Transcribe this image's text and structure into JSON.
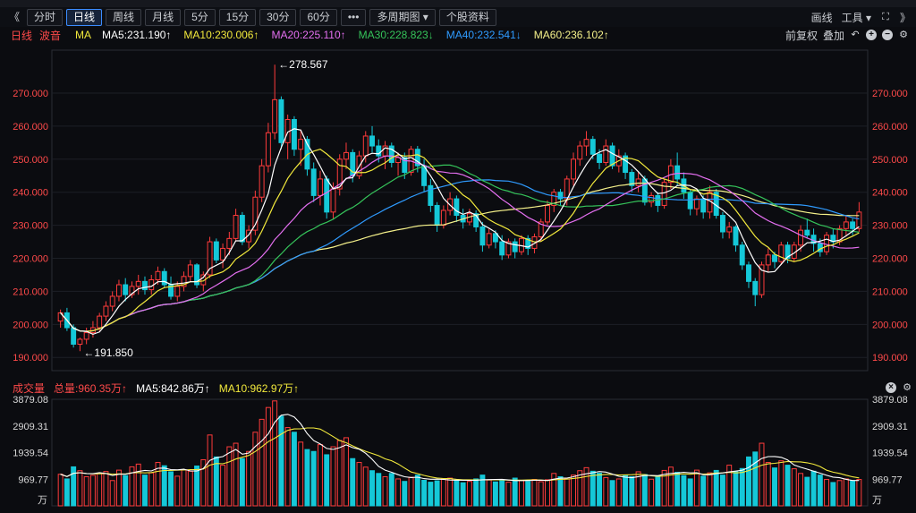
{
  "toolbar": {
    "nav_back": "《",
    "periods": [
      "分时",
      "日线",
      "周线",
      "月线",
      "5分",
      "15分",
      "30分",
      "60分"
    ],
    "active_period": "日线",
    "more": "•••",
    "multi_period": "多周期图 ▾",
    "stock_info": "个股资料",
    "draw": "画线",
    "tools": "工具 ▾",
    "nav_forward": "》"
  },
  "indicator_row": {
    "period": "日线",
    "wave": "波音",
    "ma": "MA",
    "ma5": "MA5:231.190↑",
    "ma10": "MA10:230.006↑",
    "ma20": "MA20:225.110↑",
    "ma30": "MA30:228.823↓",
    "ma40": "MA40:232.541↓",
    "ma60": "MA60:236.102↑",
    "adjust": "前复权",
    "overlay": "叠加"
  },
  "volume_row": {
    "label": "成交量",
    "total": "总量:960.35万↑",
    "ma5": "MA5:842.86万↑",
    "ma10": "MA10:962.97万↑"
  },
  "colors": {
    "up": "#ff3b3b",
    "down": "#15c8d8",
    "ma5": "#ffffff",
    "ma10": "#f2e93c",
    "ma20": "#e46ff0",
    "ma30": "#35c35a",
    "ma40": "#2f9bff",
    "ma60": "#f4f08a",
    "axis_text": "#ff4a4a",
    "vol_axis_text": "#d8d8d8"
  },
  "chart_data": {
    "type": "candlestick",
    "price_ticks": [
      "270.000",
      "260.000",
      "250.000",
      "240.000",
      "230.000",
      "220.000",
      "210.000",
      "200.000",
      "190.000"
    ],
    "price_ylim": [
      186,
      283
    ],
    "annotations": {
      "high": "←278.567",
      "low": "←191.850"
    },
    "volume_ticks": [
      "3879.08",
      "2909.31",
      "1939.54",
      "969.77"
    ],
    "volume_unit": "万",
    "volume_ylim": [
      0,
      3879.08
    ],
    "candles": [
      {
        "o": 201.0,
        "h": 204.5,
        "l": 199.0,
        "c": 203.5
      },
      {
        "o": 203.5,
        "h": 205.0,
        "l": 198.0,
        "c": 199.0
      },
      {
        "o": 199.0,
        "h": 200.0,
        "l": 193.0,
        "c": 194.0
      },
      {
        "o": 194.0,
        "h": 196.0,
        "l": 191.9,
        "c": 195.5
      },
      {
        "o": 195.5,
        "h": 199.0,
        "l": 194.0,
        "c": 197.5
      },
      {
        "o": 197.5,
        "h": 201.0,
        "l": 196.0,
        "c": 199.0
      },
      {
        "o": 199.0,
        "h": 203.5,
        "l": 198.0,
        "c": 202.5
      },
      {
        "o": 202.5,
        "h": 207.0,
        "l": 201.0,
        "c": 205.5
      },
      {
        "o": 205.5,
        "h": 210.0,
        "l": 204.0,
        "c": 208.5
      },
      {
        "o": 208.5,
        "h": 213.5,
        "l": 207.0,
        "c": 212.0
      },
      {
        "o": 212.0,
        "h": 214.0,
        "l": 207.0,
        "c": 209.0
      },
      {
        "o": 209.0,
        "h": 213.0,
        "l": 208.0,
        "c": 211.5
      },
      {
        "o": 211.5,
        "h": 215.0,
        "l": 209.0,
        "c": 213.0
      },
      {
        "o": 213.0,
        "h": 214.5,
        "l": 209.0,
        "c": 210.5
      },
      {
        "o": 210.5,
        "h": 215.0,
        "l": 209.0,
        "c": 213.5
      },
      {
        "o": 213.5,
        "h": 217.5,
        "l": 212.0,
        "c": 216.0
      },
      {
        "o": 216.0,
        "h": 217.0,
        "l": 211.0,
        "c": 212.0
      },
      {
        "o": 212.0,
        "h": 214.5,
        "l": 207.5,
        "c": 208.5
      },
      {
        "o": 208.5,
        "h": 213.0,
        "l": 207.0,
        "c": 211.5
      },
      {
        "o": 211.5,
        "h": 216.0,
        "l": 210.0,
        "c": 214.5
      },
      {
        "o": 214.5,
        "h": 219.5,
        "l": 213.0,
        "c": 218.0
      },
      {
        "o": 218.0,
        "h": 218.5,
        "l": 211.0,
        "c": 212.0
      },
      {
        "o": 212.0,
        "h": 216.0,
        "l": 210.0,
        "c": 215.0
      },
      {
        "o": 215.0,
        "h": 226.5,
        "l": 214.0,
        "c": 225.0
      },
      {
        "o": 225.0,
        "h": 226.0,
        "l": 218.5,
        "c": 219.5
      },
      {
        "o": 219.5,
        "h": 224.5,
        "l": 217.0,
        "c": 223.0
      },
      {
        "o": 223.0,
        "h": 228.0,
        "l": 221.0,
        "c": 226.0
      },
      {
        "o": 226.0,
        "h": 235.0,
        "l": 225.0,
        "c": 233.0
      },
      {
        "o": 233.0,
        "h": 234.0,
        "l": 224.0,
        "c": 225.0
      },
      {
        "o": 225.0,
        "h": 230.0,
        "l": 223.0,
        "c": 228.5
      },
      {
        "o": 228.5,
        "h": 240.5,
        "l": 227.0,
        "c": 238.5
      },
      {
        "o": 238.5,
        "h": 250.0,
        "l": 237.0,
        "c": 248.0
      },
      {
        "o": 248.0,
        "h": 261.0,
        "l": 246.0,
        "c": 258.0
      },
      {
        "o": 258.0,
        "h": 278.6,
        "l": 256.0,
        "c": 268.0
      },
      {
        "o": 268.0,
        "h": 269.0,
        "l": 253.0,
        "c": 255.0
      },
      {
        "o": 255.0,
        "h": 263.5,
        "l": 250.0,
        "c": 262.0
      },
      {
        "o": 262.0,
        "h": 263.0,
        "l": 251.0,
        "c": 253.0
      },
      {
        "o": 253.0,
        "h": 259.0,
        "l": 248.0,
        "c": 256.0
      },
      {
        "o": 256.0,
        "h": 257.0,
        "l": 245.0,
        "c": 247.0
      },
      {
        "o": 247.0,
        "h": 249.0,
        "l": 237.0,
        "c": 239.0
      },
      {
        "o": 239.0,
        "h": 246.5,
        "l": 236.0,
        "c": 244.0
      },
      {
        "o": 244.0,
        "h": 245.0,
        "l": 232.0,
        "c": 234.0
      },
      {
        "o": 234.0,
        "h": 243.0,
        "l": 232.0,
        "c": 241.0
      },
      {
        "o": 241.0,
        "h": 251.5,
        "l": 239.0,
        "c": 250.0
      },
      {
        "o": 250.0,
        "h": 255.0,
        "l": 247.0,
        "c": 252.0
      },
      {
        "o": 252.0,
        "h": 253.0,
        "l": 243.0,
        "c": 245.0
      },
      {
        "o": 245.0,
        "h": 252.5,
        "l": 244.0,
        "c": 251.0
      },
      {
        "o": 251.0,
        "h": 258.5,
        "l": 249.0,
        "c": 257.0
      },
      {
        "o": 257.0,
        "h": 260.0,
        "l": 252.0,
        "c": 254.0
      },
      {
        "o": 254.0,
        "h": 256.0,
        "l": 249.0,
        "c": 251.0
      },
      {
        "o": 251.0,
        "h": 255.5,
        "l": 247.0,
        "c": 254.0
      },
      {
        "o": 254.0,
        "h": 255.0,
        "l": 247.5,
        "c": 249.0
      },
      {
        "o": 249.0,
        "h": 252.0,
        "l": 245.0,
        "c": 250.5
      },
      {
        "o": 250.5,
        "h": 252.0,
        "l": 244.0,
        "c": 246.0
      },
      {
        "o": 246.0,
        "h": 254.0,
        "l": 245.0,
        "c": 253.0
      },
      {
        "o": 253.0,
        "h": 254.0,
        "l": 246.0,
        "c": 248.0
      },
      {
        "o": 248.0,
        "h": 250.0,
        "l": 240.0,
        "c": 242.0
      },
      {
        "o": 242.0,
        "h": 244.0,
        "l": 234.0,
        "c": 236.0
      },
      {
        "o": 236.0,
        "h": 237.0,
        "l": 228.0,
        "c": 230.0
      },
      {
        "o": 230.0,
        "h": 236.0,
        "l": 229.0,
        "c": 234.5
      },
      {
        "o": 234.5,
        "h": 240.0,
        "l": 233.0,
        "c": 238.0
      },
      {
        "o": 238.0,
        "h": 239.0,
        "l": 231.0,
        "c": 233.0
      },
      {
        "o": 233.0,
        "h": 235.0,
        "l": 229.0,
        "c": 231.0
      },
      {
        "o": 231.0,
        "h": 235.0,
        "l": 230.0,
        "c": 233.5
      },
      {
        "o": 233.5,
        "h": 234.5,
        "l": 228.0,
        "c": 229.5
      },
      {
        "o": 229.5,
        "h": 231.0,
        "l": 222.0,
        "c": 224.0
      },
      {
        "o": 224.0,
        "h": 229.0,
        "l": 223.0,
        "c": 227.5
      },
      {
        "o": 227.5,
        "h": 228.5,
        "l": 223.0,
        "c": 225.0
      },
      {
        "o": 225.0,
        "h": 227.0,
        "l": 219.5,
        "c": 221.0
      },
      {
        "o": 221.0,
        "h": 226.0,
        "l": 220.0,
        "c": 225.0
      },
      {
        "o": 225.0,
        "h": 226.0,
        "l": 220.0,
        "c": 222.0
      },
      {
        "o": 222.0,
        "h": 227.0,
        "l": 221.0,
        "c": 226.0
      },
      {
        "o": 226.0,
        "h": 227.0,
        "l": 221.0,
        "c": 223.0
      },
      {
        "o": 223.0,
        "h": 227.5,
        "l": 221.5,
        "c": 226.5
      },
      {
        "o": 226.5,
        "h": 232.0,
        "l": 225.0,
        "c": 231.0
      },
      {
        "o": 231.0,
        "h": 237.5,
        "l": 230.0,
        "c": 236.0
      },
      {
        "o": 236.0,
        "h": 241.0,
        "l": 234.0,
        "c": 240.0
      },
      {
        "o": 240.0,
        "h": 241.0,
        "l": 236.0,
        "c": 238.0
      },
      {
        "o": 238.0,
        "h": 245.0,
        "l": 236.0,
        "c": 244.0
      },
      {
        "o": 244.0,
        "h": 252.0,
        "l": 242.0,
        "c": 250.0
      },
      {
        "o": 250.0,
        "h": 255.5,
        "l": 248.0,
        "c": 254.0
      },
      {
        "o": 254.0,
        "h": 258.5,
        "l": 251.0,
        "c": 256.0
      },
      {
        "o": 256.0,
        "h": 257.0,
        "l": 250.0,
        "c": 251.5
      },
      {
        "o": 251.5,
        "h": 253.0,
        "l": 247.0,
        "c": 249.0
      },
      {
        "o": 249.0,
        "h": 256.0,
        "l": 248.0,
        "c": 254.0
      },
      {
        "o": 254.0,
        "h": 255.0,
        "l": 247.0,
        "c": 248.0
      },
      {
        "o": 248.0,
        "h": 253.0,
        "l": 246.0,
        "c": 251.0
      },
      {
        "o": 251.0,
        "h": 252.0,
        "l": 244.0,
        "c": 246.0
      },
      {
        "o": 246.0,
        "h": 247.0,
        "l": 240.0,
        "c": 242.0
      },
      {
        "o": 242.0,
        "h": 246.0,
        "l": 240.0,
        "c": 244.0
      },
      {
        "o": 244.0,
        "h": 245.0,
        "l": 236.0,
        "c": 237.0
      },
      {
        "o": 237.0,
        "h": 240.0,
        "l": 235.5,
        "c": 239.0
      },
      {
        "o": 239.0,
        "h": 240.0,
        "l": 234.0,
        "c": 236.0
      },
      {
        "o": 236.0,
        "h": 244.0,
        "l": 235.0,
        "c": 243.0
      },
      {
        "o": 243.0,
        "h": 250.0,
        "l": 241.0,
        "c": 248.0
      },
      {
        "o": 248.0,
        "h": 252.0,
        "l": 242.0,
        "c": 244.0
      },
      {
        "o": 244.0,
        "h": 246.0,
        "l": 238.0,
        "c": 240.0
      },
      {
        "o": 240.0,
        "h": 241.0,
        "l": 233.0,
        "c": 235.0
      },
      {
        "o": 235.0,
        "h": 239.0,
        "l": 233.0,
        "c": 238.0
      },
      {
        "o": 238.0,
        "h": 239.0,
        "l": 232.0,
        "c": 234.0
      },
      {
        "o": 234.0,
        "h": 242.0,
        "l": 232.0,
        "c": 240.0
      },
      {
        "o": 240.0,
        "h": 241.0,
        "l": 232.0,
        "c": 233.0
      },
      {
        "o": 233.0,
        "h": 234.0,
        "l": 226.0,
        "c": 228.0
      },
      {
        "o": 228.0,
        "h": 231.0,
        "l": 226.0,
        "c": 229.5
      },
      {
        "o": 229.5,
        "h": 230.0,
        "l": 222.0,
        "c": 224.0
      },
      {
        "o": 224.0,
        "h": 225.0,
        "l": 216.5,
        "c": 218.0
      },
      {
        "o": 218.0,
        "h": 219.0,
        "l": 211.0,
        "c": 213.0
      },
      {
        "o": 213.0,
        "h": 214.0,
        "l": 205.5,
        "c": 209.0
      },
      {
        "o": 209.0,
        "h": 219.0,
        "l": 208.0,
        "c": 218.0
      },
      {
        "o": 218.0,
        "h": 223.0,
        "l": 216.0,
        "c": 221.0
      },
      {
        "o": 221.0,
        "h": 222.0,
        "l": 217.0,
        "c": 219.0
      },
      {
        "o": 219.0,
        "h": 225.0,
        "l": 218.0,
        "c": 224.0
      },
      {
        "o": 224.0,
        "h": 225.0,
        "l": 218.5,
        "c": 220.0
      },
      {
        "o": 220.0,
        "h": 225.0,
        "l": 219.0,
        "c": 224.0
      },
      {
        "o": 224.0,
        "h": 230.0,
        "l": 222.0,
        "c": 228.5
      },
      {
        "o": 228.5,
        "h": 232.0,
        "l": 226.0,
        "c": 227.0
      },
      {
        "o": 227.0,
        "h": 229.0,
        "l": 222.0,
        "c": 224.5
      },
      {
        "o": 224.5,
        "h": 226.0,
        "l": 220.5,
        "c": 222.0
      },
      {
        "o": 222.0,
        "h": 228.0,
        "l": 221.0,
        "c": 227.0
      },
      {
        "o": 227.0,
        "h": 229.0,
        "l": 223.0,
        "c": 225.0
      },
      {
        "o": 225.0,
        "h": 230.0,
        "l": 224.0,
        "c": 229.0
      },
      {
        "o": 229.0,
        "h": 233.0,
        "l": 227.0,
        "c": 231.0
      },
      {
        "o": 231.0,
        "h": 232.0,
        "l": 227.0,
        "c": 229.0
      },
      {
        "o": 229.0,
        "h": 237.0,
        "l": 228.0,
        "c": 234.0
      }
    ],
    "volumes": [
      1150,
      980,
      1420,
      1280,
      1060,
      1110,
      1180,
      1250,
      920,
      1300,
      1100,
      1420,
      1520,
      1120,
      1200,
      1580,
      1460,
      1240,
      1080,
      1310,
      1260,
      1450,
      1680,
      2580,
      1780,
      1480,
      2150,
      2280,
      1720,
      1980,
      2680,
      3150,
      3580,
      3820,
      3260,
      2850,
      2680,
      2320,
      2050,
      1980,
      2230,
      1860,
      2150,
      2380,
      2480,
      1720,
      1580,
      1410,
      1280,
      1180,
      1060,
      1180,
      980,
      890,
      1040,
      1120,
      930,
      860,
      910,
      980,
      1010,
      920,
      840,
      890,
      980,
      1120,
      940,
      870,
      920,
      860,
      1010,
      930,
      890,
      960,
      880,
      950,
      1180,
      1060,
      980,
      1120,
      1280,
      1390,
      1260,
      1190,
      1030,
      920,
      980,
      1120,
      1060,
      1240,
      1140,
      970,
      1090,
      1290,
      1410,
      1220,
      1100,
      980,
      1300,
      1080,
      1200,
      1290,
      1120,
      1480,
      1240,
      1360,
      1780,
      1960,
      2280,
      1580,
      1380,
      1640,
      1480,
      1350,
      1180,
      1040,
      1260,
      1120,
      960,
      850,
      920,
      980,
      910,
      960
    ]
  }
}
